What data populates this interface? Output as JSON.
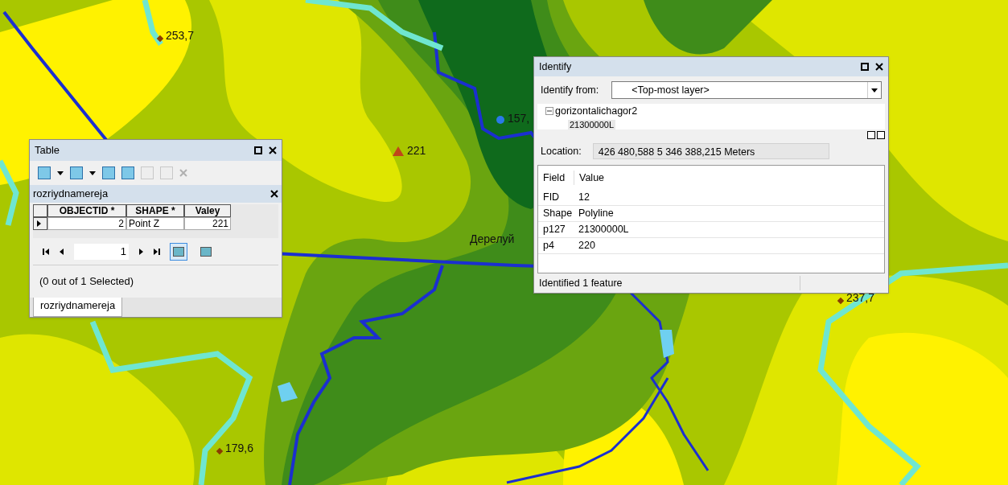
{
  "map": {
    "labels": [
      {
        "text": "253,7",
        "kind": "spot"
      },
      {
        "text": "221",
        "kind": "peak"
      },
      {
        "text": "157,",
        "kind": "point"
      },
      {
        "text": "Дерелуй",
        "kind": "place"
      },
      {
        "text": "237,7",
        "kind": "spot"
      },
      {
        "text": "179,6",
        "kind": "spot"
      }
    ]
  },
  "table_window": {
    "title": "Table",
    "layer_tab": "rozriydnamereja",
    "columns": [
      "OBJECTID *",
      "SHAPE *",
      "Valey"
    ],
    "rows": [
      [
        "2",
        "Point Z",
        "221"
      ]
    ],
    "record": "1",
    "views": [
      {
        "selected": true
      },
      {
        "selected": false
      }
    ],
    "status": "(0 out of 1 Selected)",
    "tabs": [
      {
        "label": "rozriydnamereja",
        "selected": true
      }
    ]
  },
  "identify_window": {
    "title": "Identify",
    "from_label": "Identify from:",
    "from_value": "<Top-most layer>",
    "tree": [
      {
        "label": "gorizontalichagor2",
        "expanded": true,
        "children": [
          {
            "label": "21300000L"
          }
        ]
      }
    ],
    "location_label": "Location:",
    "location_value": "426 480,588  5 346 388,215 Meters",
    "columns": [
      "Field",
      "Value"
    ],
    "rows": [
      [
        "FID",
        "12"
      ],
      [
        "Shape",
        "Polyline"
      ],
      [
        "p127",
        "21300000L"
      ],
      [
        "p4",
        "220"
      ]
    ],
    "status": "Identified 1 feature"
  }
}
